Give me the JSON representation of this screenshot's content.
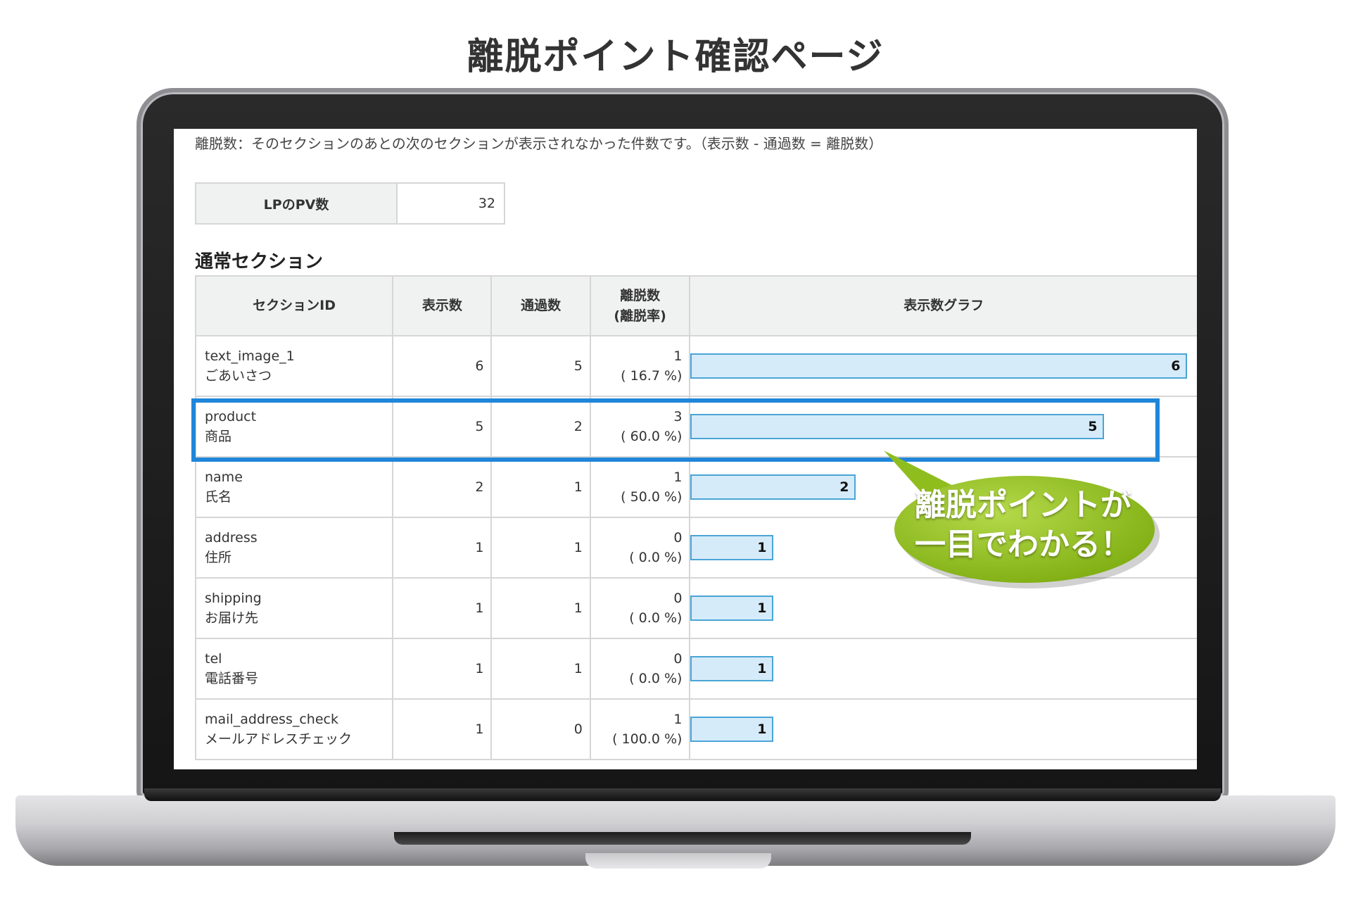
{
  "page_title": "離脱ポイント確認ページ",
  "description": "離脱数：そのセクションのあとの次のセクションが表示されなかった件数です。（表示数 - 通過数 = 離脱数）",
  "pv": {
    "label": "LPのPV数",
    "value": "32"
  },
  "section_title": "通常セクション",
  "headers": {
    "section_id": "セクションID",
    "views": "表示数",
    "passes": "通過数",
    "exits_line1": "離脱数",
    "exits_line2": "(離脱率)",
    "graph": "表示数グラフ"
  },
  "rows": [
    {
      "id": "text_image_1",
      "name": "ごあいさつ",
      "views": "6",
      "passes": "5",
      "exits": "1",
      "rate": "( 16.7 %)",
      "bar_value": 6
    },
    {
      "id": "product",
      "name": "商品",
      "views": "5",
      "passes": "2",
      "exits": "3",
      "rate": "( 60.0 %)",
      "bar_value": 5
    },
    {
      "id": "name",
      "name": "氏名",
      "views": "2",
      "passes": "1",
      "exits": "1",
      "rate": "( 50.0 %)",
      "bar_value": 2
    },
    {
      "id": "address",
      "name": "住所",
      "views": "1",
      "passes": "1",
      "exits": "0",
      "rate": "( 0.0 %)",
      "bar_value": 1
    },
    {
      "id": "shipping",
      "name": "お届け先",
      "views": "1",
      "passes": "1",
      "exits": "0",
      "rate": "( 0.0 %)",
      "bar_value": 1
    },
    {
      "id": "tel",
      "name": "電話番号",
      "views": "1",
      "passes": "1",
      "exits": "0",
      "rate": "( 0.0 %)",
      "bar_value": 1
    },
    {
      "id": "mail_address_check",
      "name": "メールアドレスチェック",
      "views": "1",
      "passes": "0",
      "exits": "1",
      "rate": "( 100.0 %)",
      "bar_value": 1
    }
  ],
  "bar_max": 6,
  "callout": {
    "line1": "離脱ポイントが",
    "line2": "一目でわかる！"
  },
  "colors": {
    "highlight": "#1f86d9",
    "bar_fill": "#d6ebf9",
    "bar_border": "#4aa5d6",
    "callout_green": "#8fbd1e"
  }
}
